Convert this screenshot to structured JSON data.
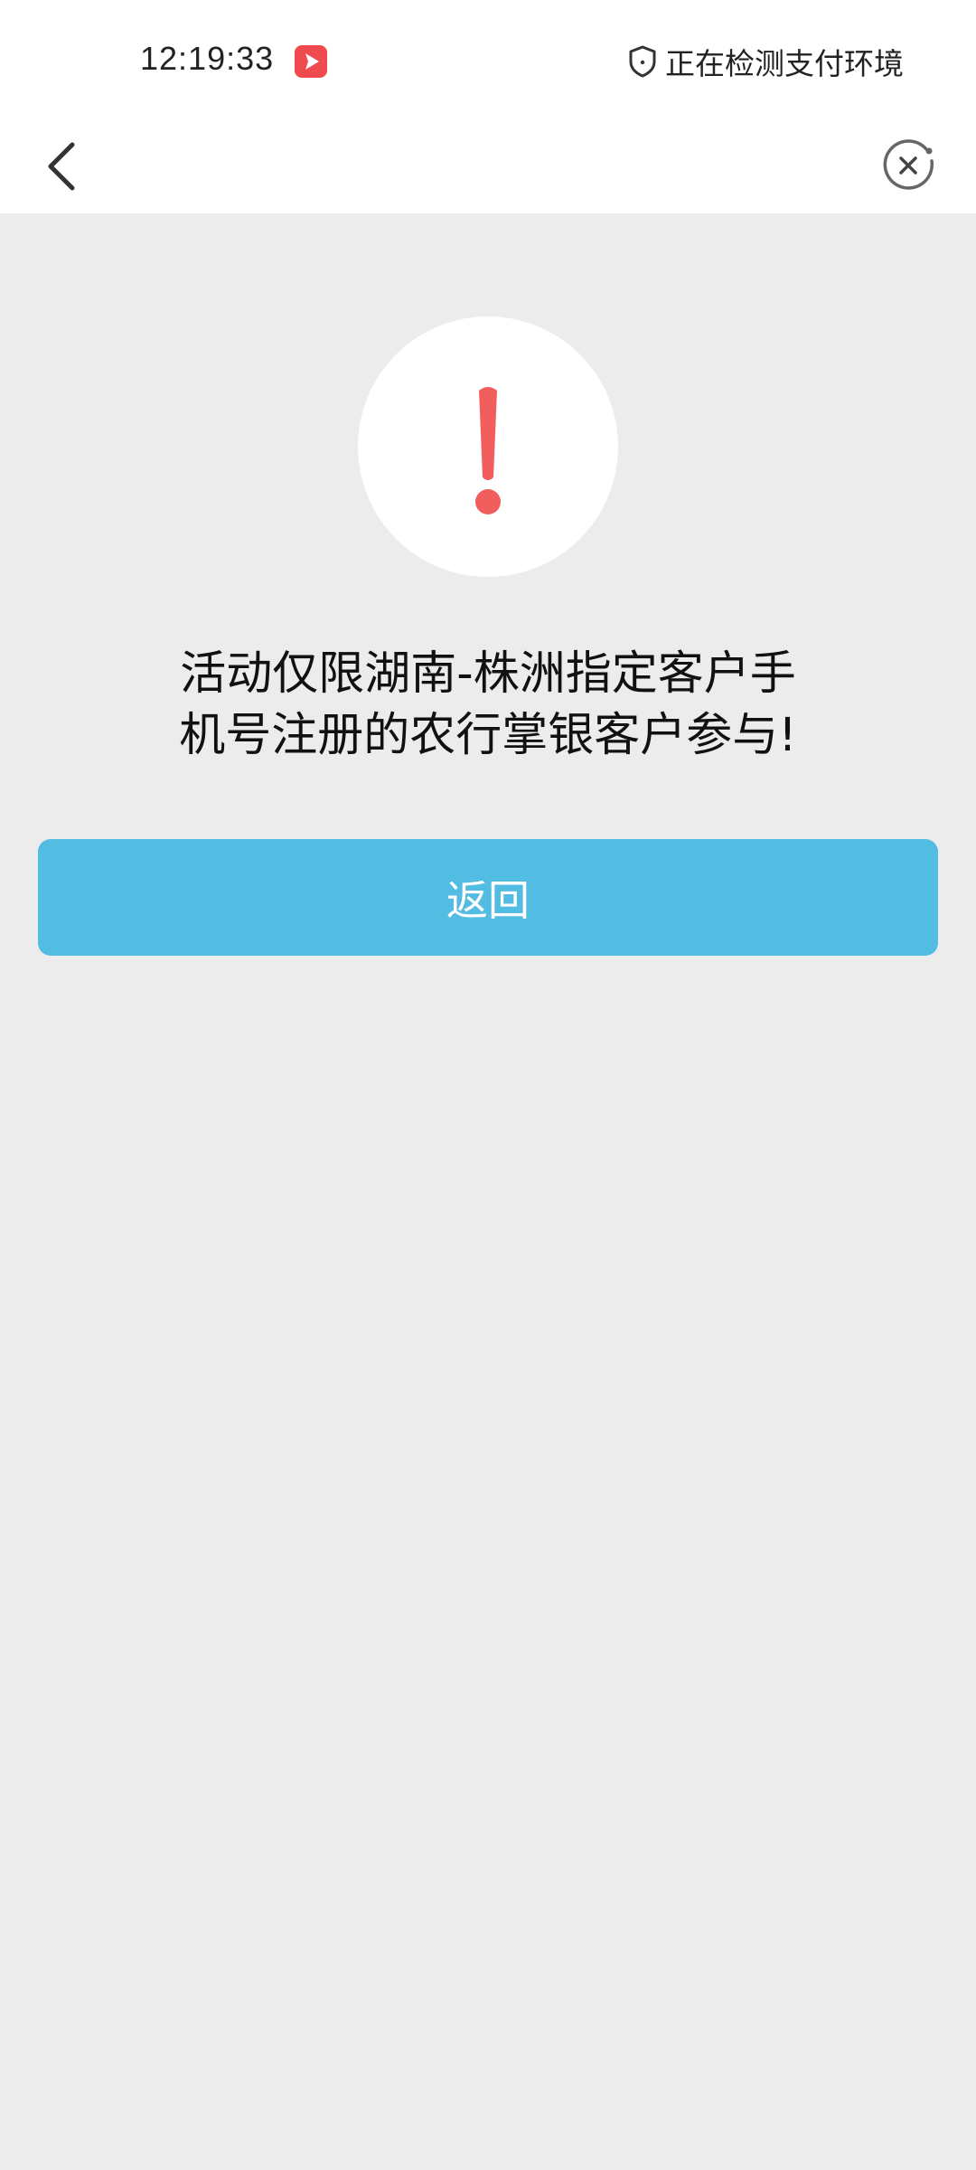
{
  "status_bar": {
    "time": "12:19:33",
    "app_icon": "video-play-icon",
    "security_icon": "shield-icon",
    "security_text": "正在检测支付环境"
  },
  "nav": {
    "back_icon": "chevron-left-icon",
    "close_icon": "close-circle-icon"
  },
  "alert": {
    "icon": "exclamation-icon",
    "icon_color": "#f25d5d",
    "message_lines": [
      "活动仅限湖南-株洲指定客户手",
      "机号注册的农行掌银客户参与!"
    ]
  },
  "actions": {
    "return_label": "返回",
    "button_color": "#53bce2"
  }
}
